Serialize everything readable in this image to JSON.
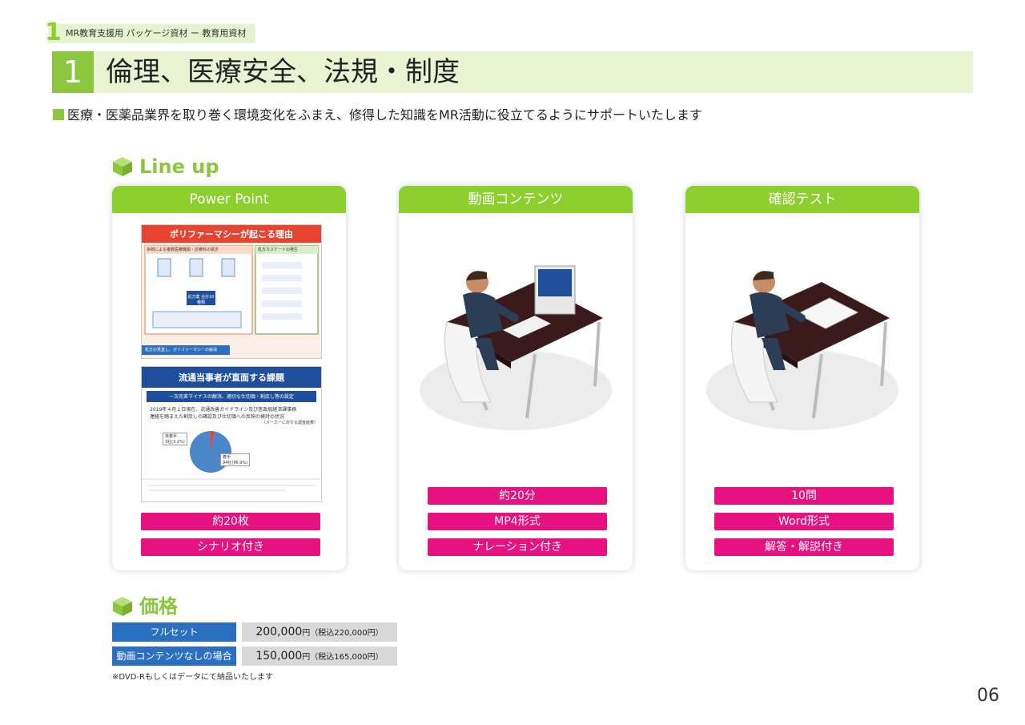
{
  "crumb": {
    "num": "1",
    "text": "MR教育支援用 パッケージ資材 ー 教育用資材"
  },
  "title": {
    "num": "1",
    "text": "倫理、医療安全、法規・制度"
  },
  "subtitle": "医療・医薬品業界を取り巻く環境変化をふまえ、修得した知識をMR活動に役立てるようにサポートいたします",
  "lineup_heading": "Line up",
  "cards": [
    {
      "header": "Power Point",
      "pills": [
        "約20枚",
        "シナリオ付き"
      ]
    },
    {
      "header": "動画コンテンツ",
      "pills": [
        "約20分",
        "MP4形式",
        "ナレーション付き"
      ]
    },
    {
      "header": "確認テスト",
      "pills": [
        "10問",
        "Word形式",
        "解答・解説付き"
      ]
    }
  ],
  "slides": {
    "slide1_title": "ポリファーマシーが起こる理由",
    "slide1_left": "多剤による複数医療機関・診療科の受診",
    "slide1_right": "処方カスケードの発生",
    "slide1_center": "処方薬 合計10種類",
    "slide1_footer": "処方の見直し、ポリファーマシーの解消",
    "slide2_title": "流通当事者が直面する課題",
    "slide2_band": "一次売差マイナスの解消、適切な仕切価・割戻し等の設定",
    "slide2_text1": "2019年４月１日現在、流通改善ガイドライン及び医政局経済課事務",
    "slide2_text2": "連絡を踏まえた割戻しの確認及び仕切価への反映の検討の状況",
    "slide2_text3": "（メーカーに対する調査結果）",
    "slide2_pie_a": "未着手",
    "slide2_pie_a_val": "3社(3.1%)",
    "slide2_pie_b": "着手",
    "slide2_pie_b_val": "94社(96.9%)"
  },
  "slide2_chart": {
    "type": "pie",
    "values": [
      3.1,
      96.9
    ],
    "labels": [
      "未着手",
      "着手"
    ]
  },
  "price_heading": "価格",
  "prices": [
    {
      "label": "フルセット",
      "price": "200,000",
      "unit": "円",
      "tax": "（税込220,000円）"
    },
    {
      "label": "動画コンテンツなしの場合",
      "price": "150,000",
      "unit": "円",
      "tax": "（税込165,000円）"
    }
  ],
  "note": "※DVD-Rもしくはデータにて納品いたします",
  "page_number": "06",
  "colors": {
    "green": "#8cc63f",
    "pink": "#e6127f",
    "blue": "#2a6fc0"
  }
}
